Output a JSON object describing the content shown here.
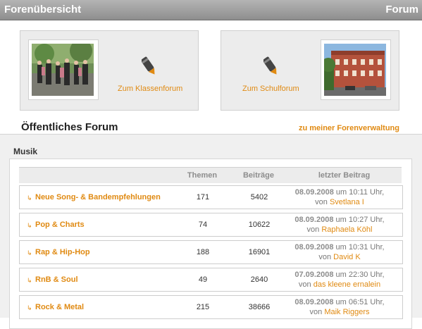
{
  "header": {
    "title_left": "Forenübersicht",
    "title_right": "Forum"
  },
  "boxes": {
    "class_forum_label": "Zum Klassenforum",
    "school_forum_label": "Zum Schulforum"
  },
  "public_forum": {
    "heading": "Öffentliches Forum",
    "manage_link": "zu meiner Forenverwaltung"
  },
  "section": {
    "title": "Musik"
  },
  "table": {
    "headers": {
      "topics": "Themen",
      "posts": "Beiträge",
      "last": "letzter Beitrag"
    },
    "rows": [
      {
        "name": "Neue Song- & Bandempfehlungen",
        "topics": "171",
        "posts": "5402",
        "date": "08.09.2008",
        "time_text": "um 10:11 Uhr,",
        "by": "von",
        "user": "Svetlana I"
      },
      {
        "name": "Pop & Charts",
        "topics": "74",
        "posts": "10622",
        "date": "08.09.2008",
        "time_text": "um 10:27 Uhr,",
        "by": "von",
        "user": "Raphaela Köhl"
      },
      {
        "name": "Rap & Hip-Hop",
        "topics": "188",
        "posts": "16901",
        "date": "08.09.2008",
        "time_text": "um 10:31 Uhr,",
        "by": "von",
        "user": "David K"
      },
      {
        "name": "RnB & Soul",
        "topics": "49",
        "posts": "2640",
        "date": "07.09.2008",
        "time_text": "um 22:30 Uhr,",
        "by": "von",
        "user": "das kleene ernalein"
      },
      {
        "name": "Rock & Metal",
        "topics": "215",
        "posts": "38666",
        "date": "08.09.2008",
        "time_text": "um 06:51 Uhr,",
        "by": "von",
        "user": "Maik Riggers"
      }
    ]
  },
  "icons": {
    "pen": "pencil-icon",
    "bullet": "arrow-bullet-icon"
  },
  "colors": {
    "accent": "#e08a12",
    "header_bar": "#9a9a9a"
  }
}
